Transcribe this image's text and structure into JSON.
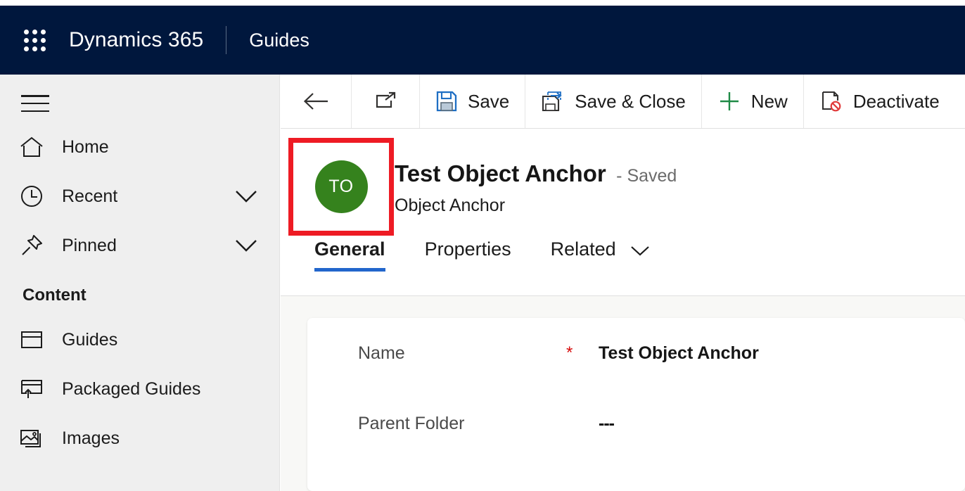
{
  "topbar": {
    "waffle_icon": "waffle-grid-icon",
    "brand": "Dynamics 365",
    "app_name": "Guides"
  },
  "sidebar": {
    "menu_icon": "hamburger-menu-icon",
    "items": [
      {
        "label": "Home",
        "icon": "home-icon",
        "expandable": false
      },
      {
        "label": "Recent",
        "icon": "clock-icon",
        "expandable": true
      },
      {
        "label": "Pinned",
        "icon": "pin-icon",
        "expandable": true
      }
    ],
    "group_title": "Content",
    "content_items": [
      {
        "label": "Guides",
        "icon": "guide-window-icon"
      },
      {
        "label": "Packaged Guides",
        "icon": "packaged-guide-icon"
      },
      {
        "label": "Images",
        "icon": "images-icon"
      }
    ]
  },
  "commandbar": {
    "back_icon": "back-arrow-icon",
    "popout_icon": "open-in-new-window-icon",
    "buttons": [
      {
        "label": "Save",
        "icon": "save-floppy-icon"
      },
      {
        "label": "Save & Close",
        "icon": "save-and-close-icon"
      },
      {
        "label": "New",
        "icon": "plus-icon"
      },
      {
        "label": "Deactivate",
        "icon": "deactivate-document-icon"
      }
    ]
  },
  "record": {
    "avatar_initials": "TO",
    "avatar_color": "#35821d",
    "highlight_color": "#ee1b24",
    "title": "Test Object Anchor",
    "status": "- Saved",
    "subtitle": "Object Anchor"
  },
  "tabs": [
    {
      "label": "General",
      "active": true,
      "has_chevron": false
    },
    {
      "label": "Properties",
      "active": false,
      "has_chevron": false
    },
    {
      "label": "Related",
      "active": false,
      "has_chevron": true
    }
  ],
  "form": {
    "fields": [
      {
        "label": "Name",
        "required": "*",
        "value": "Test Object Anchor"
      },
      {
        "label": "Parent Folder",
        "required": "",
        "value": "---"
      }
    ]
  }
}
